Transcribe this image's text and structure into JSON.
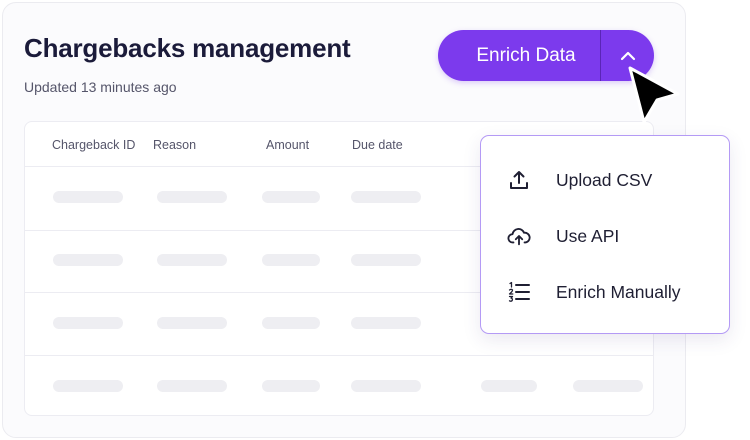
{
  "header": {
    "title": "Chargebacks management",
    "subtitle": "Updated 13 minutes ago"
  },
  "enrich_button": {
    "label": "Enrich Data",
    "toggle_icon": "chevron-up-icon",
    "color": "#7c3aed"
  },
  "table": {
    "columns": [
      "Chargeback ID",
      "Reason",
      "Amount",
      "Due date"
    ],
    "row_count": 4,
    "loading": true
  },
  "dropdown": {
    "border_color": "#b49af5",
    "items": [
      {
        "label": "Upload CSV",
        "icon": "upload-icon"
      },
      {
        "label": "Use API",
        "icon": "cloud-upload-icon"
      },
      {
        "label": "Enrich Manually",
        "icon": "numbered-list-icon"
      }
    ]
  }
}
